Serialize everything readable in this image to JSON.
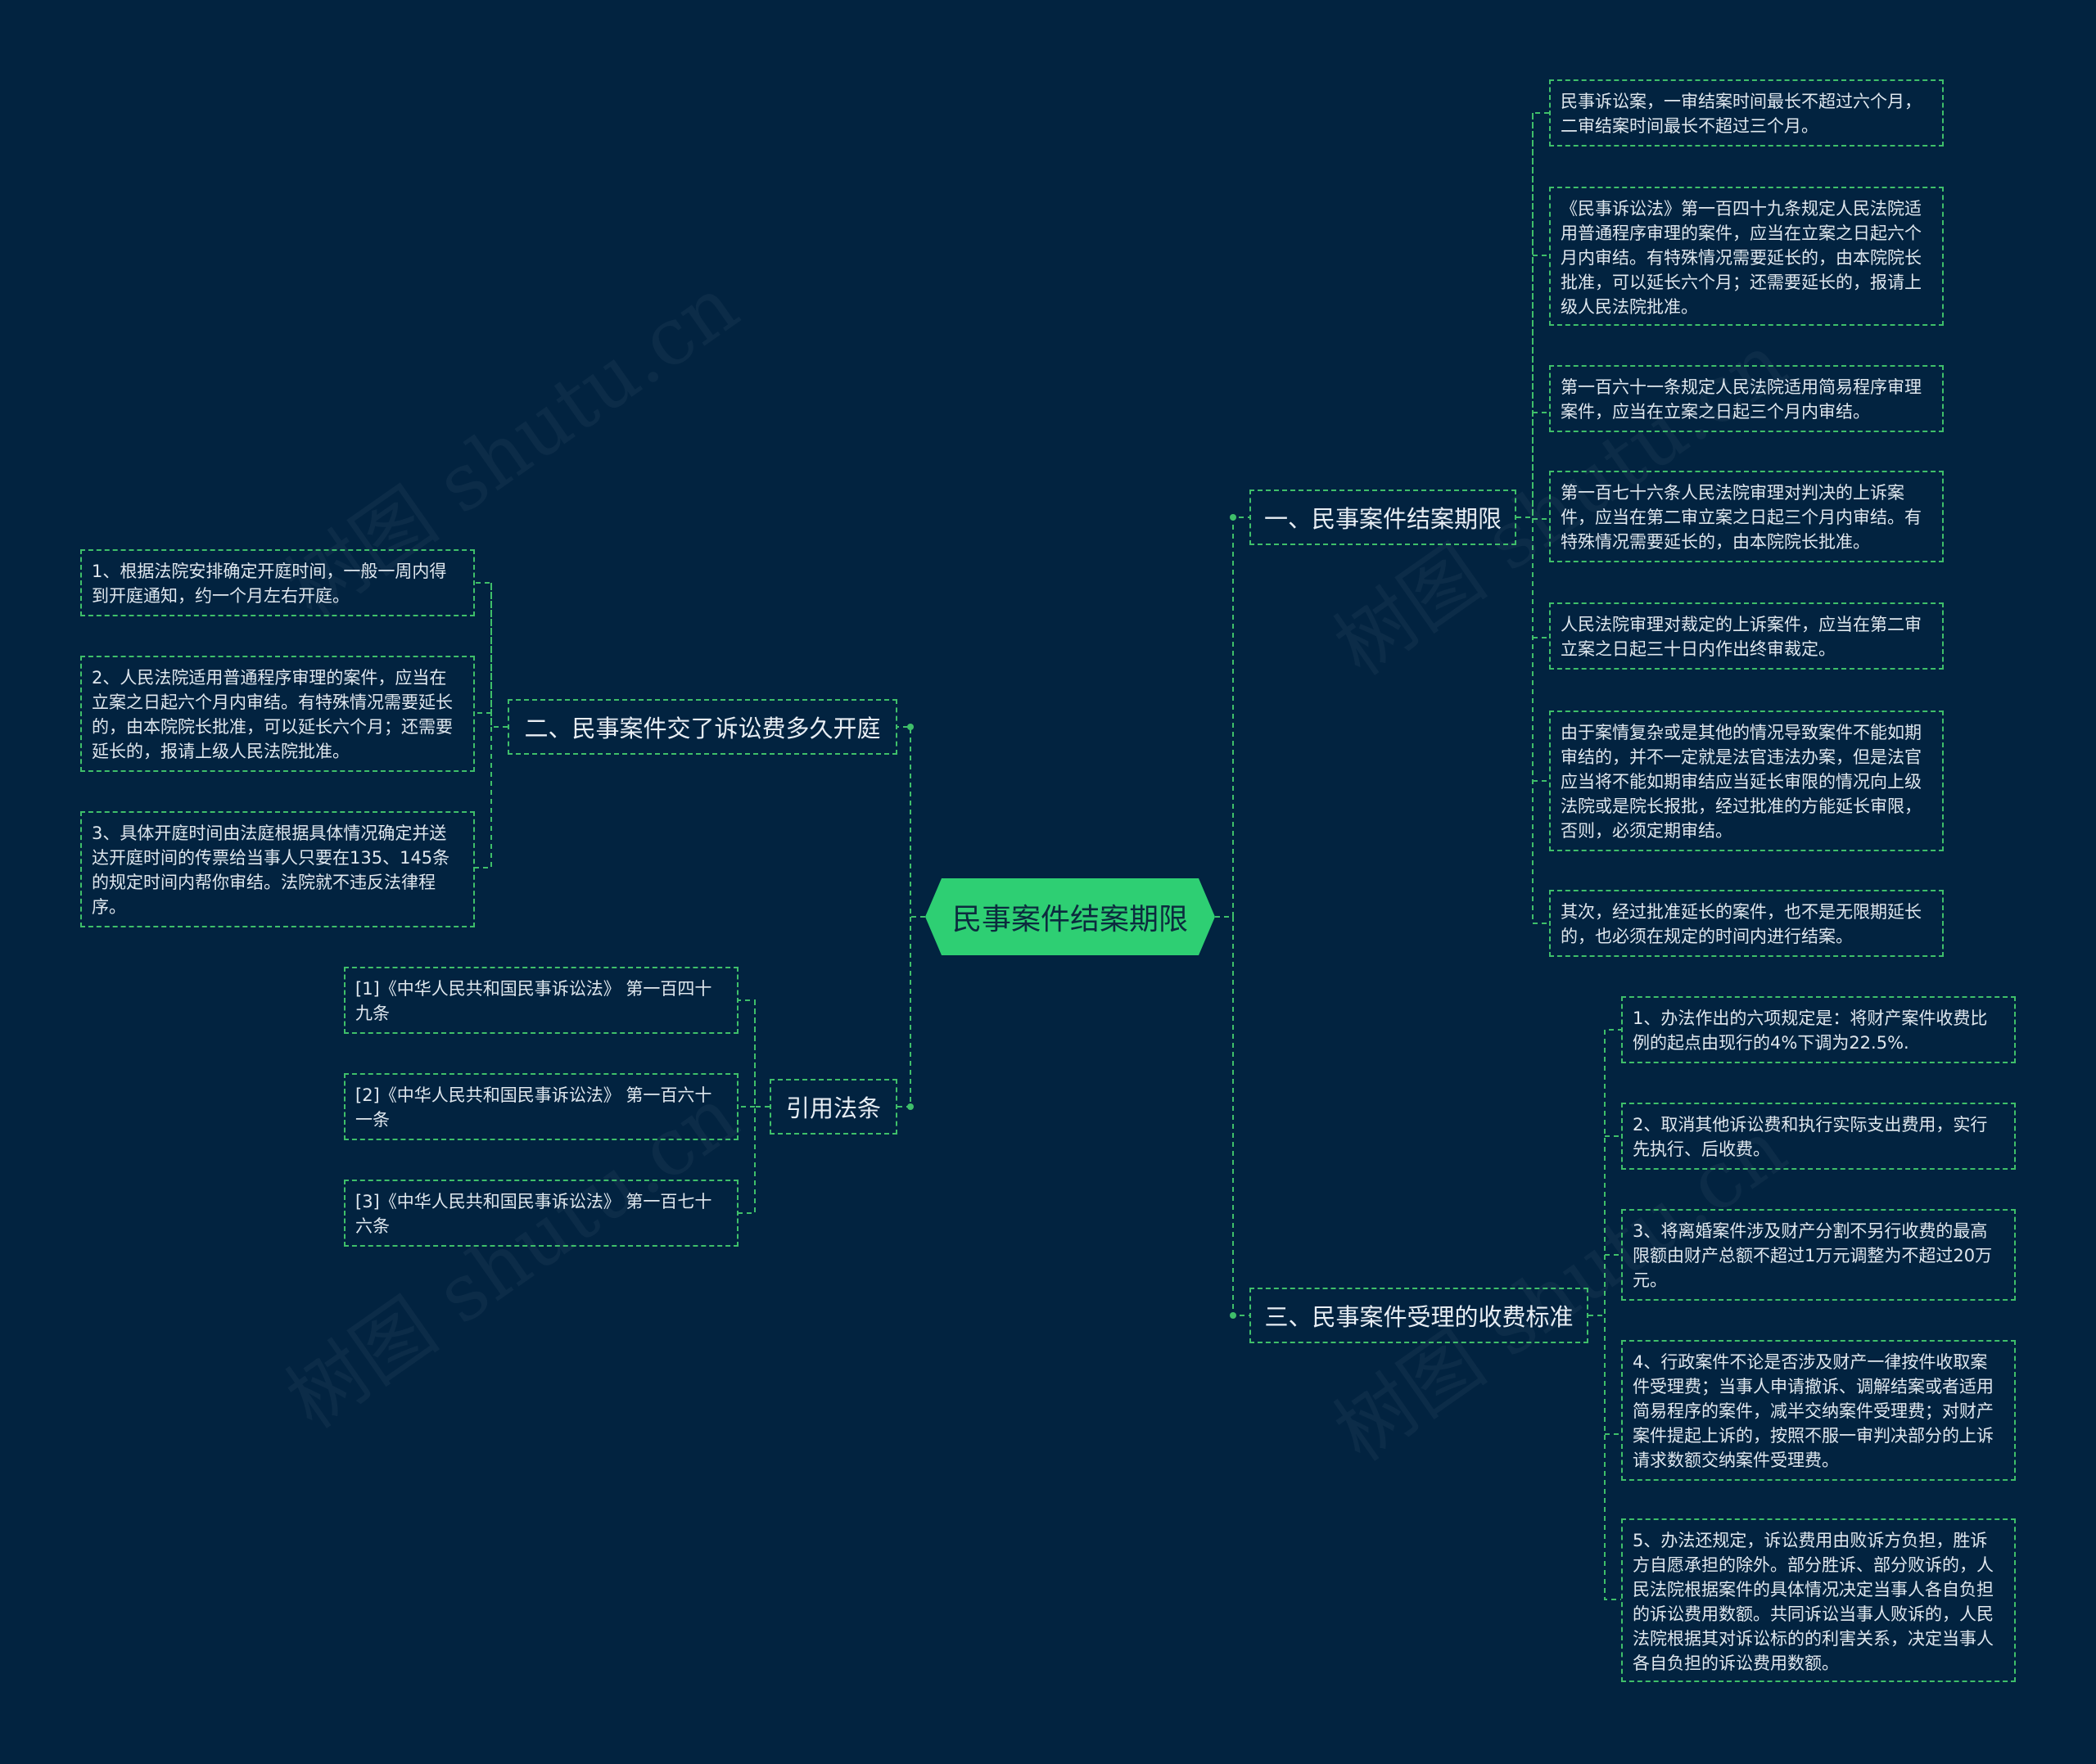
{
  "root": "民事案件结案期限",
  "branches": {
    "b1": {
      "label": "一、民事案件结案期限",
      "leaves": [
        "民事诉讼案，一审结案时间最长不超过六个月，二审结案时间最长不超过三个月。",
        "《民事诉讼法》第一百四十九条规定人民法院适用普通程序审理的案件，应当在立案之日起六个月内审结。有特殊情况需要延长的，由本院院长批准，可以延长六个月；还需要延长的，报请上级人民法院批准。",
        "第一百六十一条规定人民法院适用简易程序审理案件，应当在立案之日起三个月内审结。",
        "第一百七十六条人民法院审理对判决的上诉案件，应当在第二审立案之日起三个月内审结。有特殊情况需要延长的，由本院院长批准。",
        "人民法院审理对裁定的上诉案件，应当在第二审立案之日起三十日内作出终审裁定。",
        "由于案情复杂或是其他的情况导致案件不能如期审结的，并不一定就是法官违法办案，但是法官应当将不能如期审结应当延长审限的情况向上级法院或是院长报批，经过批准的方能延长审限，否则，必须定期审结。",
        "其次，经过批准延长的案件，也不是无限期延长的，也必须在规定的时间内进行结案。"
      ]
    },
    "b2": {
      "label": "二、民事案件交了诉讼费多久开庭",
      "leaves": [
        "1、根据法院安排确定开庭时间，一般一周内得到开庭通知，约一个月左右开庭。",
        "2、人民法院适用普通程序审理的案件，应当在立案之日起六个月内审结。有特殊情况需要延长的，由本院院长批准，可以延长六个月；还需要延长的，报请上级人民法院批准。",
        "3、具体开庭时间由法庭根据具体情况确定并送达开庭时间的传票给当事人只要在135、145条的规定时间内帮你审结。法院就不违反法律程序。"
      ]
    },
    "b3": {
      "label": "三、民事案件受理的收费标准",
      "leaves": [
        "1、办法作出的六项规定是：将财产案件收费比例的起点由现行的4%下调为22.5%.",
        "2、取消其他诉讼费和执行实际支出费用，实行先执行、后收费。",
        "3、将离婚案件涉及财产分割不另行收费的最高限额由财产总额不超过1万元调整为不超过20万元。",
        "4、行政案件不论是否涉及财产一律按件收取案件受理费；当事人申请撤诉、调解结案或者适用简易程序的案件，减半交纳案件受理费；对财产案件提起上诉的，按照不服一审判决部分的上诉请求数额交纳案件受理费。",
        "5、办法还规定，诉讼费用由败诉方负担，胜诉方自愿承担的除外。部分胜诉、部分败诉的，人民法院根据案件的具体情况决定当事人各自负担的诉讼费用数额。共同诉讼当事人败诉的，人民法院根据其对诉讼标的的利害关系，决定当事人各自负担的诉讼费用数额。"
      ]
    },
    "b4": {
      "label": "引用法条",
      "leaves": [
        "[1]《中华人民共和国民事诉讼法》 第一百四十九条",
        "[2]《中华人民共和国民事诉讼法》 第一百六十一条",
        "[3]《中华人民共和国民事诉讼法》 第一百七十六条"
      ]
    }
  },
  "watermark": "树图 shutu.cn",
  "colors": {
    "background": "#022340",
    "root": "#2ecf73",
    "line": "#3fbf6a"
  }
}
